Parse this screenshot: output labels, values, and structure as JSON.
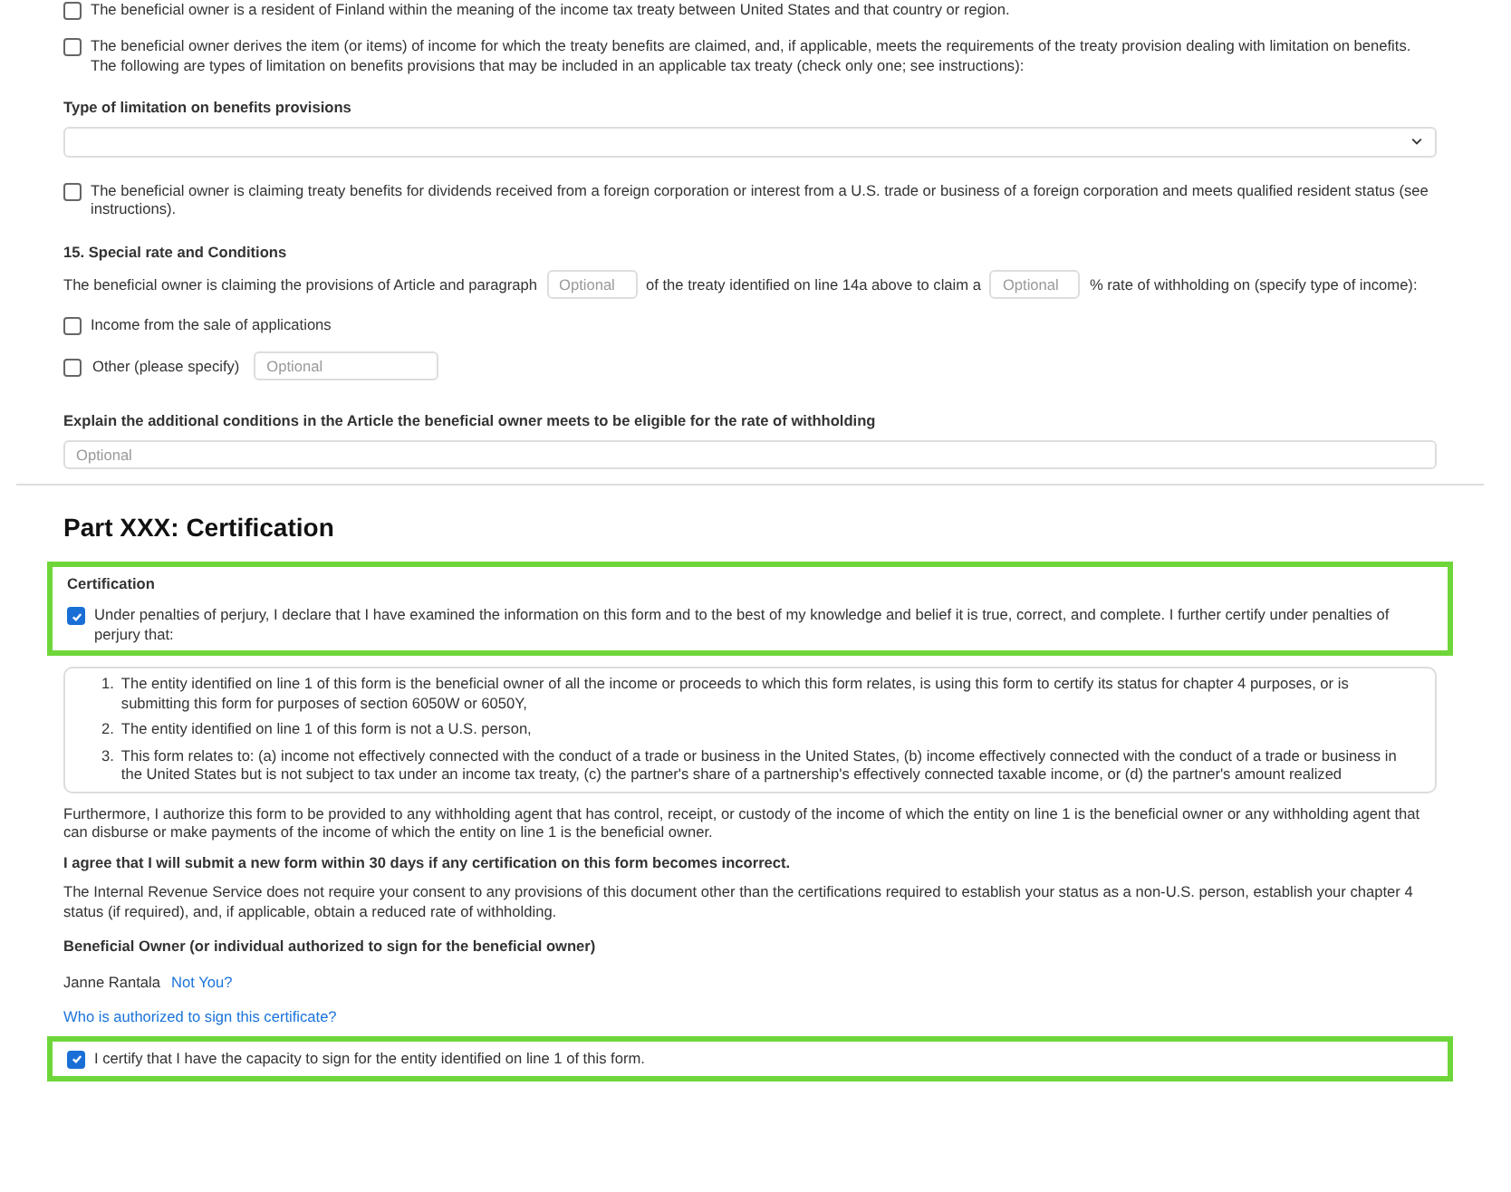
{
  "treaty_claims": {
    "resident_option": {
      "text": "The beneficial owner is a resident of Finland within the meaning of the income tax treaty between United States and that country or region.",
      "checked": false
    },
    "lob_option": {
      "text": "The beneficial owner derives the item (or items) of income for which the treaty benefits are claimed, and, if applicable, meets the requirements of the treaty provision dealing with limitation on benefits. The following are types of limitation on benefits provisions that may be included in an applicable tax treaty (check only one; see instructions):",
      "checked": false
    },
    "lob_type": {
      "label": "Type of limitation on benefits provisions"
    },
    "qualified_resident_option": {
      "text": "The beneficial owner is claiming treaty benefits for dividends received from a foreign corporation or interest from a U.S. trade or business of a foreign corporation and meets qualified resident status (see instructions).",
      "checked": false
    }
  },
  "special_rate": {
    "heading": "15. Special rate and Conditions",
    "sentence_parts": [
      "The beneficial owner is claiming the provisions of Article and paragraph",
      "of the treaty identified on line 14a above to claim a",
      "% rate of withholding on (specify type of income):"
    ],
    "article_field": {
      "placeholder": "Optional"
    },
    "rate_field": {
      "placeholder": "Optional"
    },
    "income_options": [
      {
        "kind": "plain",
        "text": "Income from the sale of applications",
        "checked": false
      },
      {
        "kind": "specify",
        "text": "Other (please specify)",
        "checked": false,
        "placeholder": "Optional"
      }
    ],
    "conditions": {
      "label": "Explain the additional conditions in the Article the beneficial owner meets to be eligible for the rate of withholding",
      "placeholder": "Optional"
    }
  },
  "part_title": "Part XXX: Certification",
  "certification": {
    "label": "Certification",
    "perjury": {
      "text": "Under penalties of perjury, I declare that I have examined the information on this form and to the best of my knowledge and belief it is true, correct, and complete. I further certify under penalties of perjury that:",
      "checked": true,
      "highlighted": true
    },
    "statements": [
      {
        "number": "1.",
        "text": "The entity identified on line 1 of this form is the beneficial owner of all the income or proceeds to which this form relates, is using this form to certify its status for chapter 4 purposes, or is submitting this form for purposes of section 6050W or 6050Y,"
      },
      {
        "number": "2.",
        "text": "The entity identified on line 1 of this form is not a U.S. person,"
      },
      {
        "number": "3.",
        "text": "This form relates to: (a) income not effectively connected with the conduct of a trade or business in the United States, (b) income effectively connected with the conduct of a trade or business in the United States but is not subject to tax under an income tax treaty, (c) the partner's share of a partnership's effectively connected taxable income, or (d) the partner's amount realized"
      }
    ],
    "paragraphs": [
      {
        "kind": "plain",
        "text": "Furthermore, I authorize this form to be provided to any withholding agent that has control, receipt, or custody of the income of which the entity on line 1 is the beneficial owner or any withholding agent that can disburse or make payments of the income of which the entity on line 1 is the beneficial owner."
      },
      {
        "kind": "bold",
        "text": "I agree that I will submit a new form within 30 days if any certification on this form becomes incorrect."
      },
      {
        "kind": "plain",
        "text": "The Internal Revenue Service does not require your consent to any provisions of this document other than the certifications required to establish your status as a non-U.S. person, establish your chapter 4 status (if required), and, if applicable, obtain a reduced rate of withholding."
      }
    ],
    "owner_heading": "Beneficial Owner (or individual authorized to sign for the beneficial owner)",
    "owner_name": "Janne Rantala",
    "not_you_link": "Not You?",
    "authorized_link": "Who is authorized to sign this certificate?",
    "capacity": {
      "text": "I certify that I have the capacity to sign for the entity identified on line 1 of this form.",
      "checked": true,
      "highlighted": true
    }
  }
}
